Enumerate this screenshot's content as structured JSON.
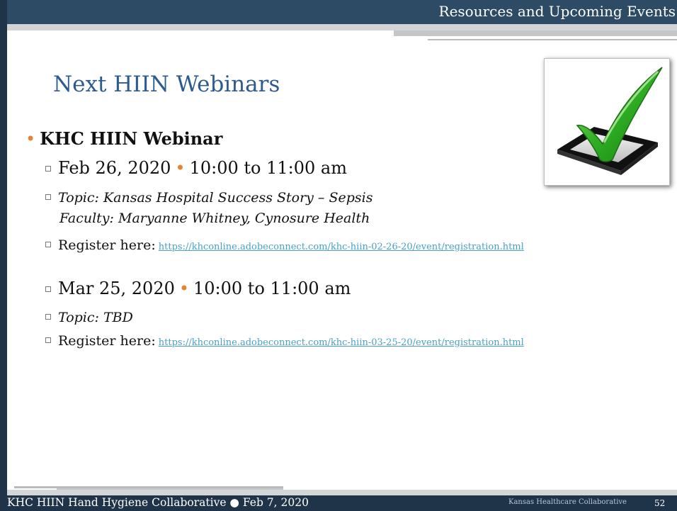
{
  "header": {
    "title": "Resources and Upcoming Events"
  },
  "slide": {
    "title": "Next HIIN Webinars"
  },
  "content": {
    "heading": "KHC HIIN Webinar",
    "events": [
      {
        "date": "Feb 26, 2020",
        "time": "10:00 to 11:00 am",
        "topic": "Topic: Kansas Hospital Success Story – Sepsis",
        "faculty": "Faculty:  Maryanne Whitney, Cynosure Health",
        "register_label": "Register here:",
        "register_url": "https://khconline.adobeconnect.com/khc-hiin-02-26-20/event/registration.html"
      },
      {
        "date": "Mar 25, 2020",
        "time": "10:00 to 11:00 am",
        "topic": "Topic: TBD",
        "register_label": "Register here:",
        "register_url": "https://khconline.adobeconnect.com/khc-hiin-03-25-20/event/registration.html"
      }
    ]
  },
  "footer": {
    "left": "KHC HIIN Hand Hygiene Collaborative ● Feb 7, 2020",
    "center": "Kansas Healthcare Collaborative",
    "page_number": "52"
  },
  "colors": {
    "dark_navy": "#1f3349",
    "banner_blue": "#2e4b66",
    "title_blue": "#2e5b8e",
    "accent_orange": "#e7822f",
    "link_blue": "#4aa0c9",
    "check_green": "#2fae24"
  },
  "icons": {
    "checkmark": "checkbox-check-icon",
    "sub_bullet": "square-bullet-icon"
  }
}
